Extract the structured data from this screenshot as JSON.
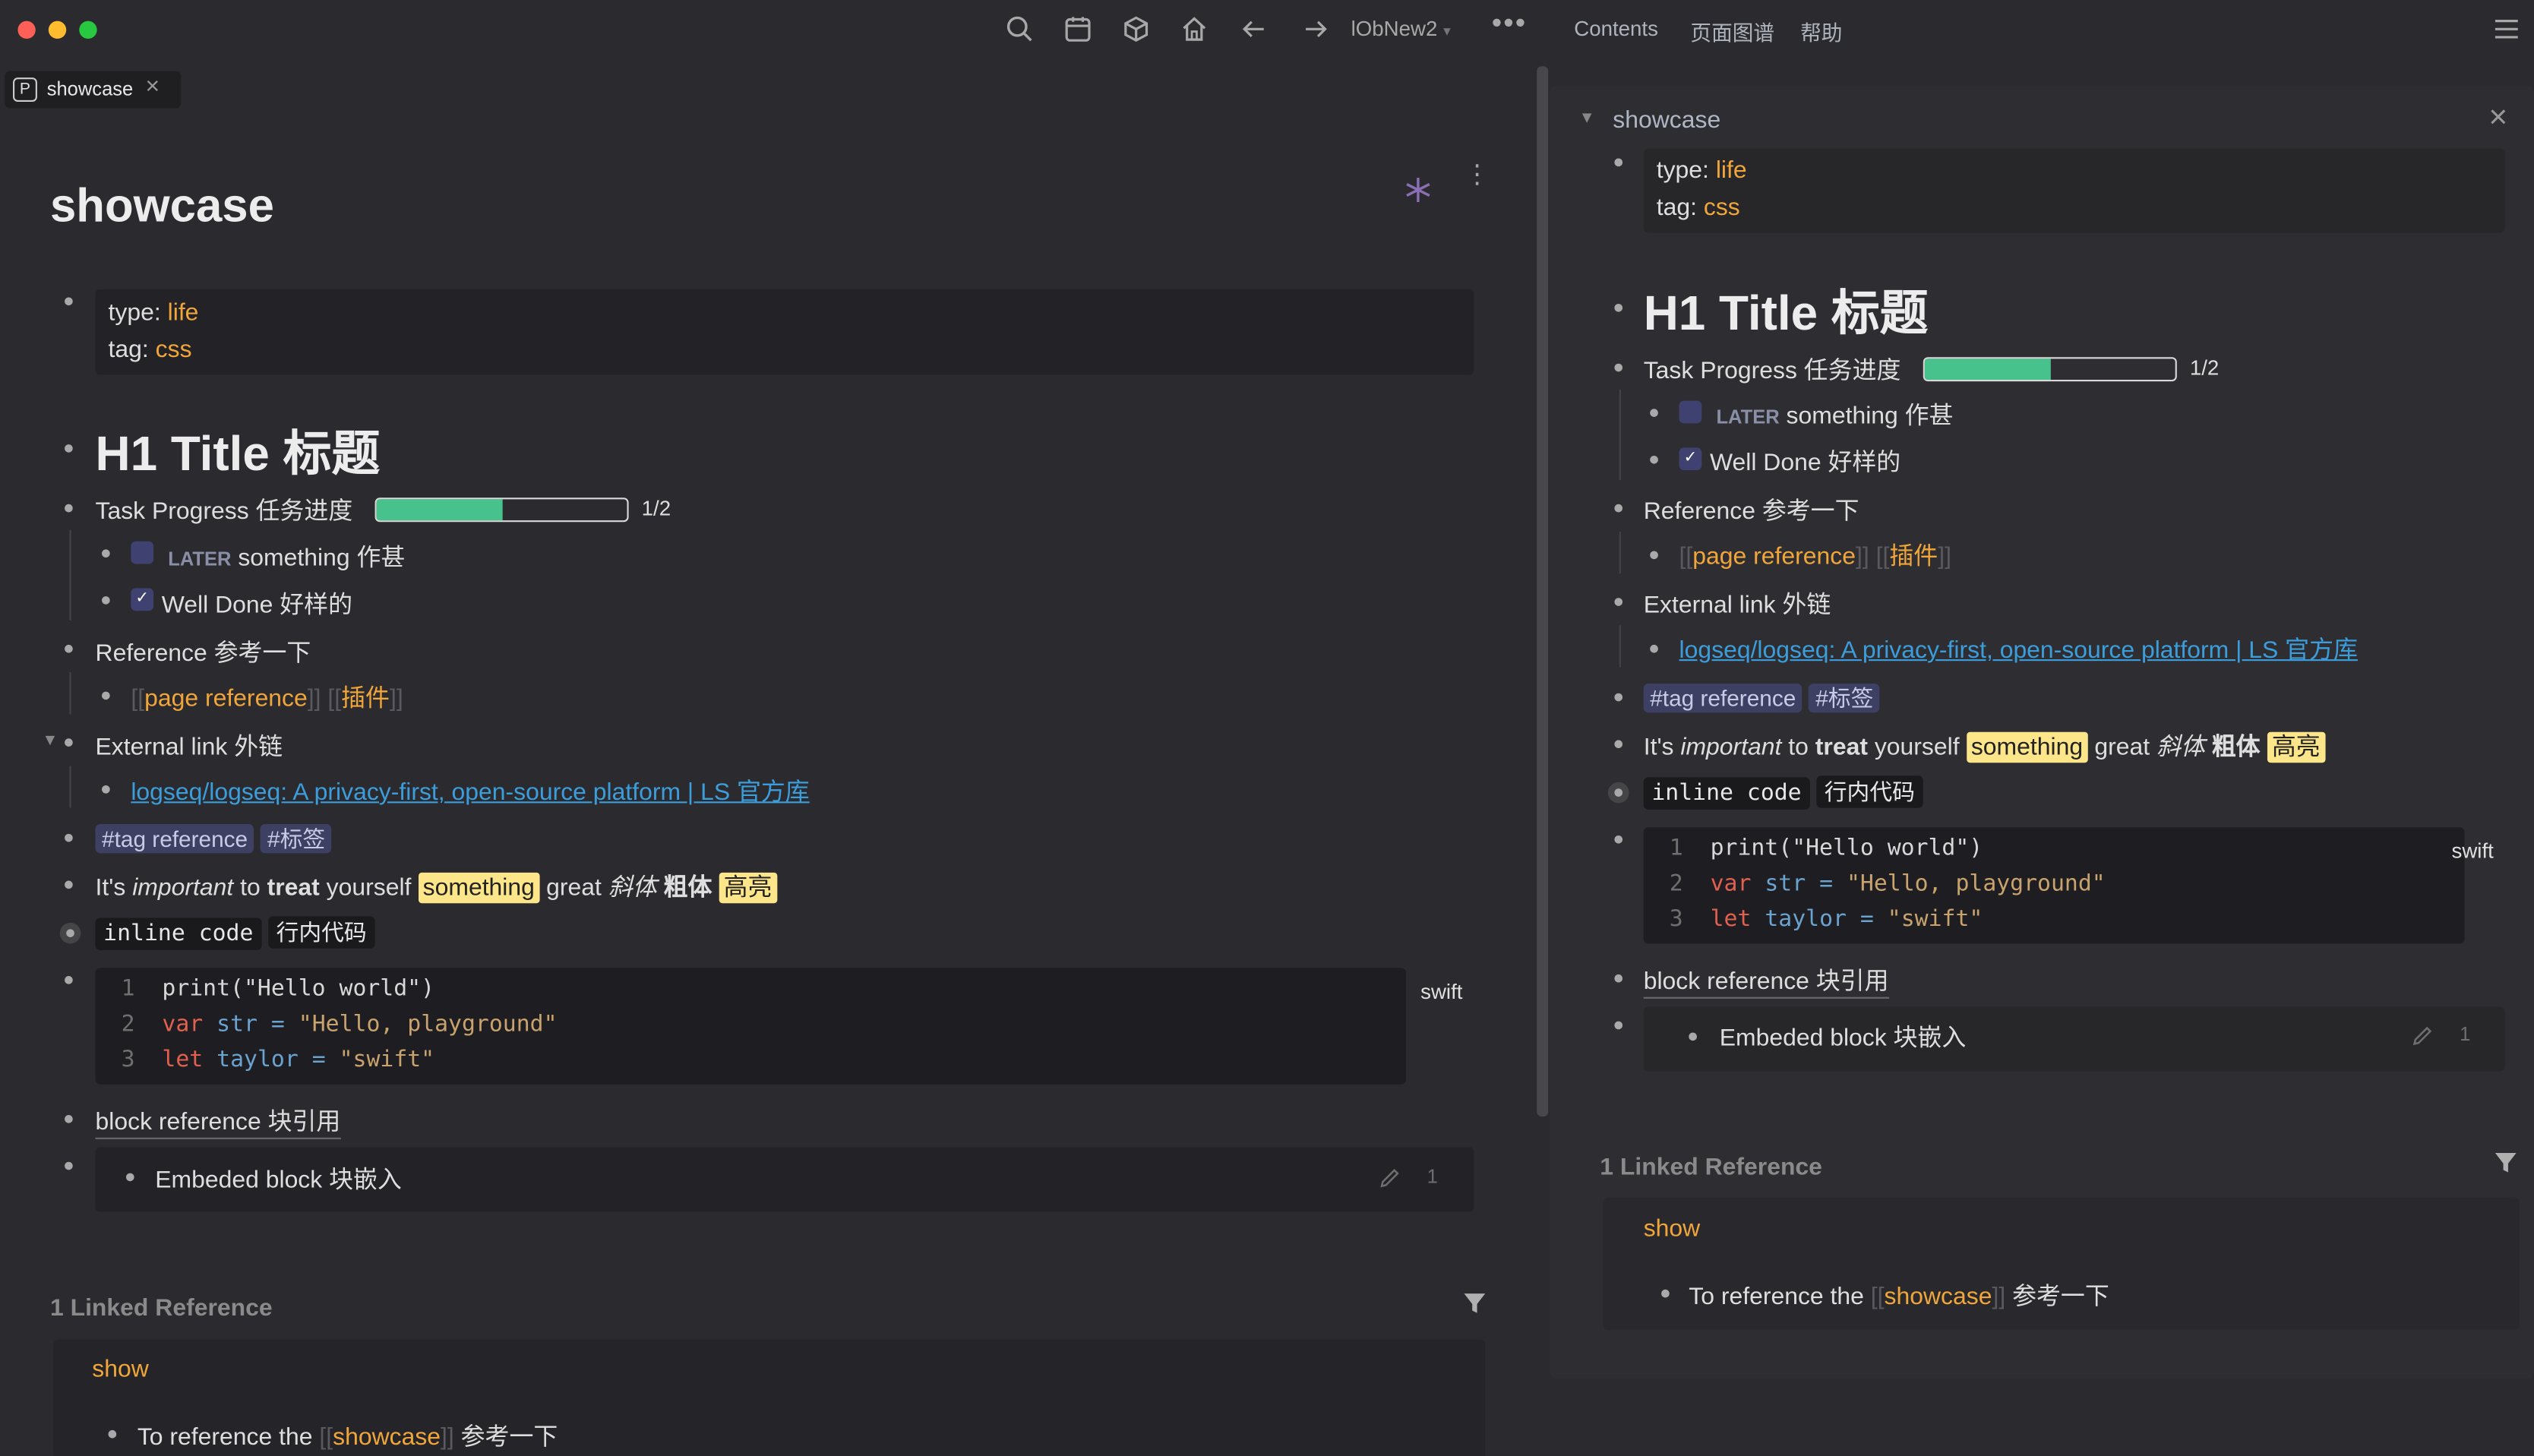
{
  "topbar": {
    "graph_name": "lObNew2",
    "right_links": [
      "Contents",
      "页面图谱",
      "帮助"
    ]
  },
  "tab": {
    "badge": "P",
    "label": "showcase"
  },
  "page": {
    "title": "showcase",
    "props": {
      "type_key": "type:",
      "type_val": "life",
      "tag_key": "tag:",
      "tag_val": "css"
    },
    "h1": "H1 Title 标题",
    "task_progress": {
      "label": "Task Progress 任务进度",
      "fraction": 0.5,
      "text": "1/2"
    },
    "task_later": {
      "marker": "LATER",
      "text": "something 作甚"
    },
    "task_done": {
      "text": "Well Done 好样的"
    },
    "reference": {
      "label": "Reference 参考一下",
      "page_ref": "page reference",
      "page_ref2": "插件"
    },
    "external": {
      "label": "External link 外链",
      "link": "logseq/logseq: A privacy-first, open-source platform | LS 官方库"
    },
    "tags": [
      "#tag reference",
      "#标签"
    ],
    "rich": {
      "p1": "It's ",
      "em": "important",
      "p2": " to ",
      "strong": "treat",
      "p3": " yourself ",
      "mark": "something",
      "p4": " great ",
      "em_cn": "斜体",
      "strong_cn": "粗体",
      "mark_cn": "高亮"
    },
    "inline": {
      "code": "inline code",
      "code_cn": "行内代码"
    },
    "code_block": {
      "lang": "swift",
      "lines": [
        {
          "n": "1",
          "a": "print(\"Hello world\")"
        },
        {
          "n": "2",
          "kw": "var",
          "v": "str",
          "eq": " = ",
          "s": "\"Hello, playground\""
        },
        {
          "n": "3",
          "kw": "let",
          "v": "taylor",
          "eq": " = ",
          "s": "\"swift\""
        }
      ]
    },
    "block_ref": "block reference 块引用",
    "embed": {
      "text": "Embeded block 块嵌入",
      "count": "1"
    },
    "linked": {
      "header": "1 Linked Reference",
      "page": "show",
      "item_pre": "To reference the ",
      "item_ref": "showcase",
      "item_post": " 参考一下"
    }
  },
  "sidebar": {
    "title": "showcase"
  },
  "colors": {
    "progress": "#47c28d",
    "orange": "#f0a63a",
    "link": "#3c9ddb",
    "highlight": "#fde68a"
  }
}
